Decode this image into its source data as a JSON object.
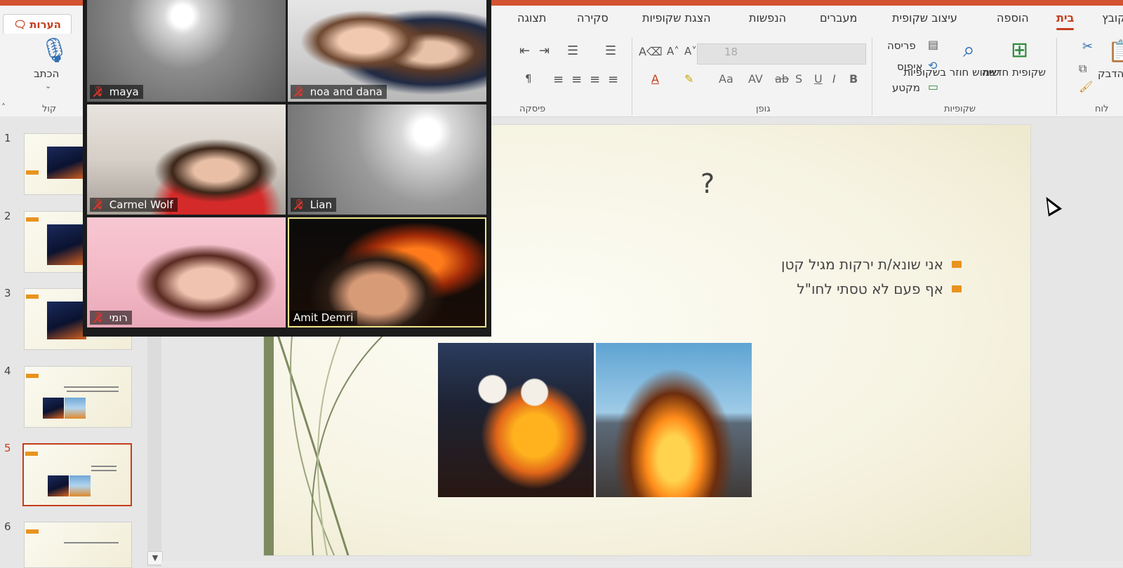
{
  "ribbon": {
    "comments_label": "הערות",
    "tabs": [
      "קובץ",
      "בית",
      "הוספה",
      "עיצוב שקופית",
      "מעברים",
      "הנפשות",
      "הצגת שקופיות",
      "סקירה",
      "תצוגה"
    ],
    "active_tab": "בית",
    "groups": {
      "clipboard": {
        "label": "לוח",
        "paste": "הדבק"
      },
      "slides": {
        "label": "שקופיות",
        "new_slide": "שקופית חדשה",
        "reuse": "שימוש חוזר בשקופיות",
        "layout": "פריסה",
        "reset": "איפוס",
        "section": "מקטע"
      },
      "font": {
        "label": "גופן",
        "size": "18"
      },
      "paragraph": {
        "label": "פיסקה"
      },
      "voice": {
        "label": "קול",
        "dictate": "הכתב"
      }
    },
    "accent_color": "#c43e1c"
  },
  "slides_panel": {
    "numbers": [
      "1",
      "2",
      "3",
      "4",
      "5",
      "6"
    ],
    "selected": "5"
  },
  "slide": {
    "title": "?",
    "bullets": [
      "אני שונא/ת ירקות מגיל קטן",
      "אף פעם לא טסתי לחו\"ל"
    ]
  },
  "participants": [
    {
      "name": "maya",
      "muted": true
    },
    {
      "name": "noa and dana",
      "muted": true
    },
    {
      "name": "Carmel Wolf",
      "muted": true
    },
    {
      "name": "Lian",
      "muted": true
    },
    {
      "name": "רומי",
      "muted": true
    },
    {
      "name": "Amit Demri",
      "muted": false,
      "active_speaker": true
    }
  ]
}
